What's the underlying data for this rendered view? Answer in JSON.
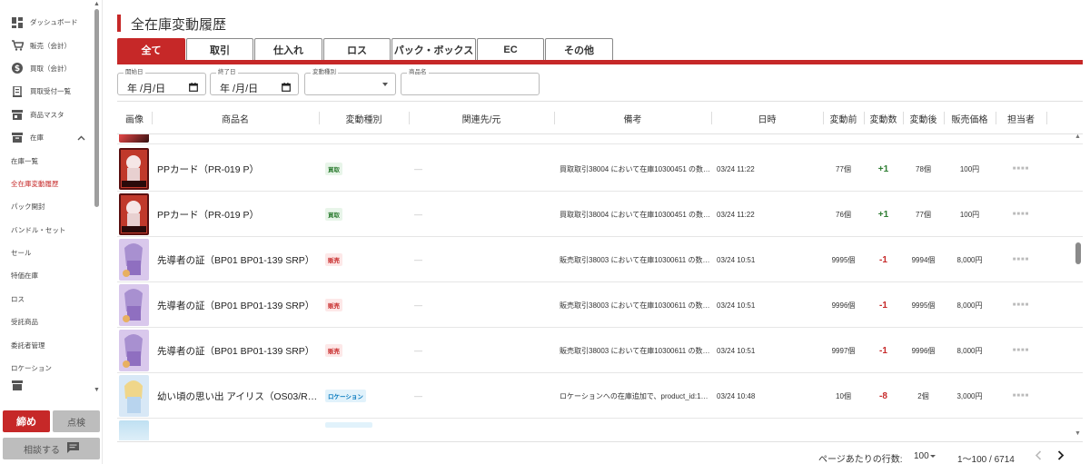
{
  "sidebar": {
    "items": [
      {
        "label": "ダッシュボード",
        "icon": "dashboard-icon"
      },
      {
        "label": "販売（会計）",
        "icon": "cart-icon"
      },
      {
        "label": "買取（会計）",
        "icon": "dollar-icon"
      },
      {
        "label": "買取受付一覧",
        "icon": "receipt-icon"
      },
      {
        "label": "商品マスタ",
        "icon": "store-icon"
      },
      {
        "label": "在庫",
        "icon": "archive-icon"
      },
      {
        "label": "在庫一覧"
      },
      {
        "label": "全在庫変動履歴"
      },
      {
        "label": "パック開封"
      },
      {
        "label": "バンドル・セット"
      },
      {
        "label": "セール"
      },
      {
        "label": "特価在庫"
      },
      {
        "label": "ロス"
      },
      {
        "label": "受託商品"
      },
      {
        "label": "委託者管理"
      },
      {
        "label": "ロケーション"
      }
    ],
    "close_label": "締め",
    "check_label": "点検",
    "consult_label": "相談する"
  },
  "page": {
    "title": "全在庫変動履歴"
  },
  "tabs": [
    "全て",
    "取引",
    "仕入れ",
    "ロス",
    "パック・ボックス",
    "EC",
    "その他"
  ],
  "filters": {
    "start_label": "開始日",
    "start_value": "年 /月/日",
    "end_label": "終了日",
    "end_value": "年 /月/日",
    "type_label": "変動種別",
    "name_label": "商品名"
  },
  "table": {
    "columns": [
      "画像",
      "商品名",
      "変動種別",
      "関連先/元",
      "備考",
      "日時",
      "変動前",
      "変動数",
      "変動後",
      "販売価格",
      "担当者"
    ],
    "rows": [
      {
        "name": "PPカード（PR-019 P）",
        "type": "買取",
        "type_kind": "buy",
        "related": "—",
        "note": "買取取引38004 において在庫10300451 の数…",
        "datetime": "03/24 11:22",
        "before": "77個",
        "delta": "+1",
        "after": "78個",
        "price": "100円",
        "staff": "■■■■"
      },
      {
        "name": "PPカード（PR-019 P）",
        "type": "買取",
        "type_kind": "buy",
        "related": "—",
        "note": "買取取引38004 において在庫10300451 の数…",
        "datetime": "03/24 11:22",
        "before": "76個",
        "delta": "+1",
        "after": "77個",
        "price": "100円",
        "staff": "■■■■"
      },
      {
        "name": "先導者の証（BP01 BP01-139 SRP）",
        "type": "販売",
        "type_kind": "sell",
        "related": "—",
        "note": "販売取引38003 において在庫10300611 の数…",
        "datetime": "03/24 10:51",
        "before": "9995個",
        "delta": "-1",
        "after": "9994個",
        "price": "8,000円",
        "staff": "■■■■"
      },
      {
        "name": "先導者の証（BP01 BP01-139 SRP）",
        "type": "販売",
        "type_kind": "sell",
        "related": "—",
        "note": "販売取引38003 において在庫10300611 の数…",
        "datetime": "03/24 10:51",
        "before": "9996個",
        "delta": "-1",
        "after": "9995個",
        "price": "8,000円",
        "staff": "■■■■"
      },
      {
        "name": "先導者の証（BP01 BP01-139 SRP）",
        "type": "販売",
        "type_kind": "sell",
        "related": "—",
        "note": "販売取引38003 において在庫10300611 の数…",
        "datetime": "03/24 10:51",
        "before": "9997個",
        "delta": "-1",
        "after": "9996個",
        "price": "8,000円",
        "staff": "■■■■"
      },
      {
        "name": "幼い頃の思い出 アイリス（OS03/R…",
        "type": "ロケーション",
        "type_kind": "loc",
        "related": "—",
        "note": "ロケーションへの在庫追加で、product_id:1…",
        "datetime": "03/24 10:48",
        "before": "10個",
        "delta": "-8",
        "after": "2個",
        "price": "3,000円",
        "staff": "■■■■"
      }
    ]
  },
  "footer": {
    "rows_per_page_label": "ページあたりの行数:",
    "rows_per_page_value": "100",
    "range": "1～100 / 6714"
  },
  "colors": {
    "accent": "#c62828",
    "positive": "#2e7d32",
    "negative": "#c62828"
  }
}
